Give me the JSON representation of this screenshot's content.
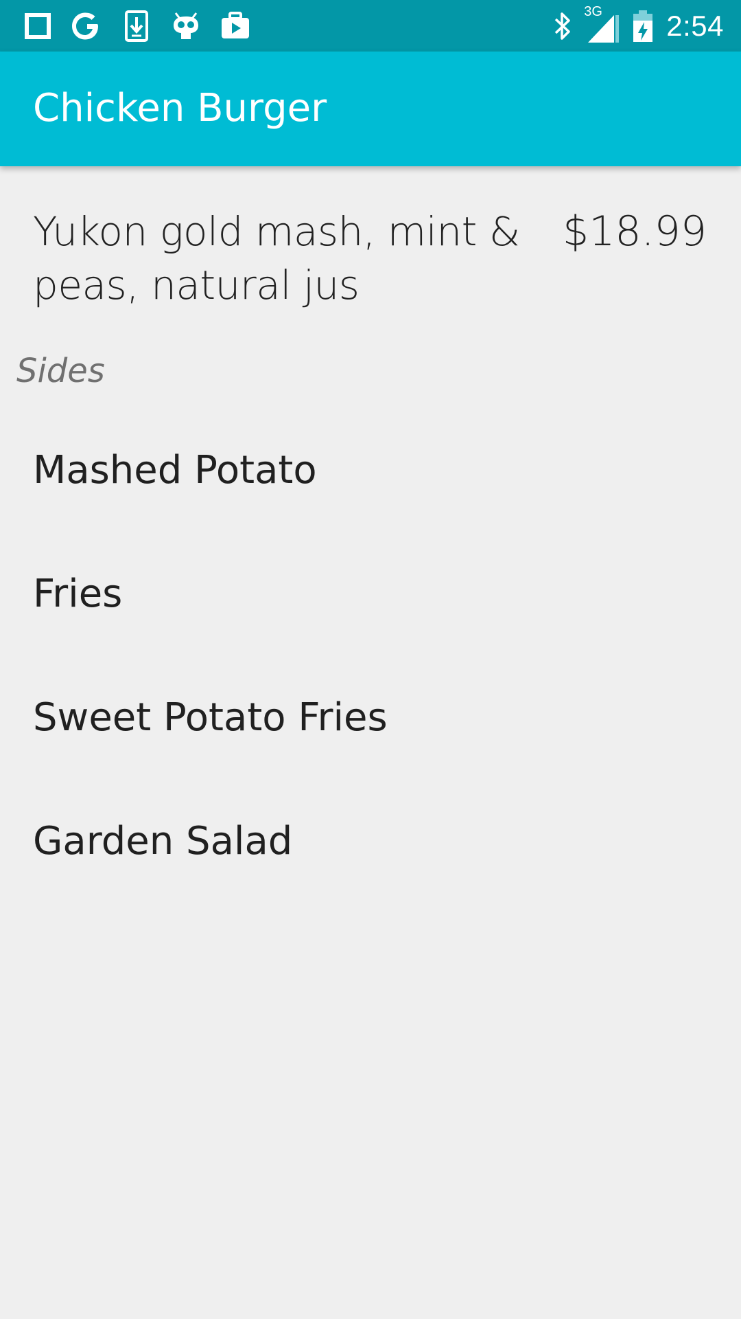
{
  "status_bar": {
    "left_icons": [
      "square-notification-icon",
      "google-icon",
      "download-icon",
      "cyanogen-icon",
      "briefcase-play-icon"
    ],
    "right_icons": [
      "bluetooth-icon",
      "signal-3g-icon",
      "battery-charging-icon"
    ],
    "network_label": "3G",
    "time": "2:54",
    "color": "#0397a7"
  },
  "app_bar": {
    "title": "Chicken Burger",
    "color": "#00bcd4"
  },
  "item": {
    "description": "Yukon gold mash, mint & peas, natural jus",
    "price": "$18.99"
  },
  "sides": {
    "header": "Sides",
    "items": [
      {
        "label": "Mashed Potato"
      },
      {
        "label": "Fries"
      },
      {
        "label": "Sweet Potato Fries"
      },
      {
        "label": "Garden Salad"
      }
    ]
  }
}
